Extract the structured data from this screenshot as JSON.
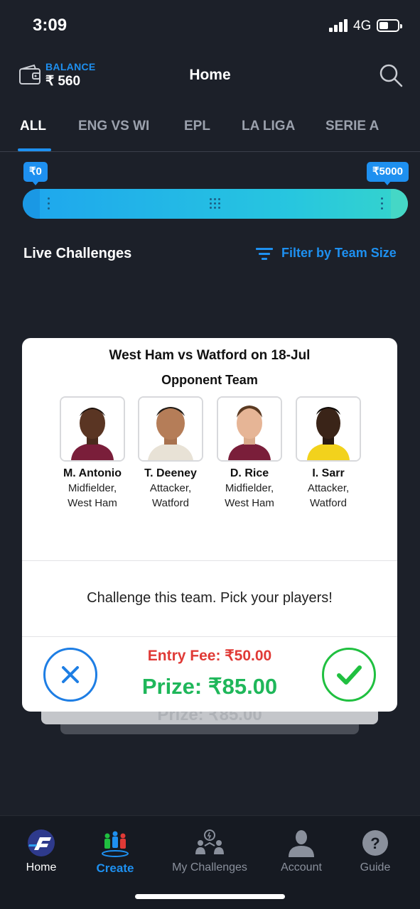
{
  "status_bar": {
    "time": "3:09",
    "network": "4G"
  },
  "header": {
    "balance_label": "BALANCE",
    "balance_value": "₹ 560",
    "title": "Home"
  },
  "tabs": [
    {
      "label": "ALL",
      "active": true
    },
    {
      "label": "ENG VS WI",
      "active": false
    },
    {
      "label": "EPL",
      "active": false
    },
    {
      "label": "LA LIGA",
      "active": false
    },
    {
      "label": "SERIE A",
      "active": false
    }
  ],
  "range_slider": {
    "min_label": "₹0",
    "max_label": "₹5000",
    "selected_min_fraction": 0,
    "selected_max_fraction": 1
  },
  "section": {
    "title": "Live Challenges",
    "filter_label": "Filter by Team Size"
  },
  "challenge_card": {
    "title": "West Ham vs Watford on 18-Jul",
    "subtitle": "Opponent Team",
    "players": [
      {
        "name": "M. Antonio",
        "role": "Midfielder,",
        "team": "West Ham"
      },
      {
        "name": "T. Deeney",
        "role": "Attacker,",
        "team": "Watford"
      },
      {
        "name": "D. Rice",
        "role": "Midfielder,",
        "team": "West Ham"
      },
      {
        "name": "I. Sarr",
        "role": "Attacker,",
        "team": "Watford"
      }
    ],
    "cta": "Challenge this team. Pick your players!",
    "entry_fee": "Entry Fee: ₹50.00",
    "prize": "Prize: ₹85.00"
  },
  "background_card": {
    "prize": "Prize: ₹85.00"
  },
  "bottom_nav": [
    {
      "label": "Home",
      "icon": "home-logo-icon"
    },
    {
      "label": "Create",
      "icon": "create-team-icon"
    },
    {
      "label": "My Challenges",
      "icon": "my-challenges-icon"
    },
    {
      "label": "Account",
      "icon": "account-icon"
    },
    {
      "label": "Guide",
      "icon": "guide-icon"
    }
  ],
  "colors": {
    "background": "#1c2029",
    "accent": "#1e90f0",
    "entry_fee": "#e03a36",
    "prize": "#1fb75a",
    "accept": "#20c040"
  }
}
